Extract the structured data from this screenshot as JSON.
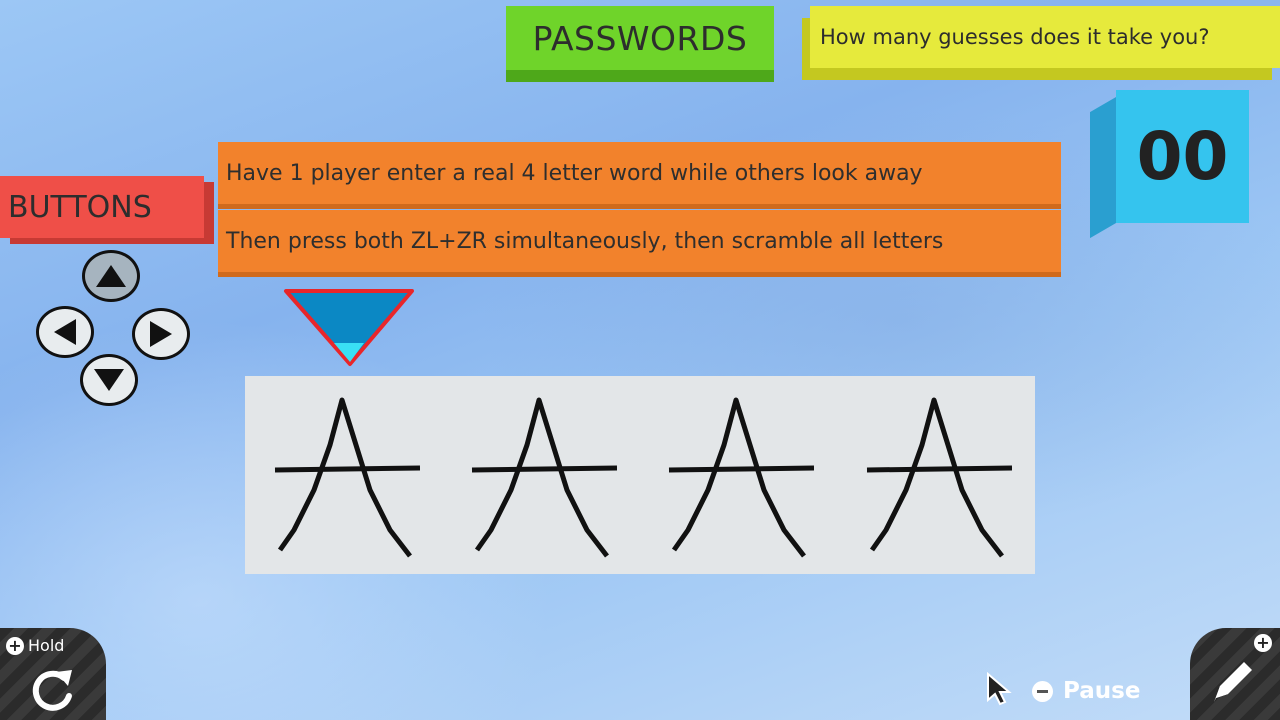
{
  "header": {
    "passwords_label": "PASSWORDS",
    "question": "How many guesses does it take you?",
    "guess_count": "00"
  },
  "buttons_label": "BUTTONS",
  "instructions": [
    "Have 1 player enter a real 4 letter word while others look away",
    "Then press both ZL+ZR simultaneously, then scramble all letters"
  ],
  "letters": [
    "A",
    "A",
    "A",
    "A"
  ],
  "selected_slot": 1,
  "controls": {
    "hold_label": "Hold",
    "pause_label": "Pause"
  },
  "colors": {
    "green": "#6fd42a",
    "yellow": "#e6ea3c",
    "blue": "#35c4ee",
    "red": "#ef4f48",
    "orange": "#f2822c"
  }
}
